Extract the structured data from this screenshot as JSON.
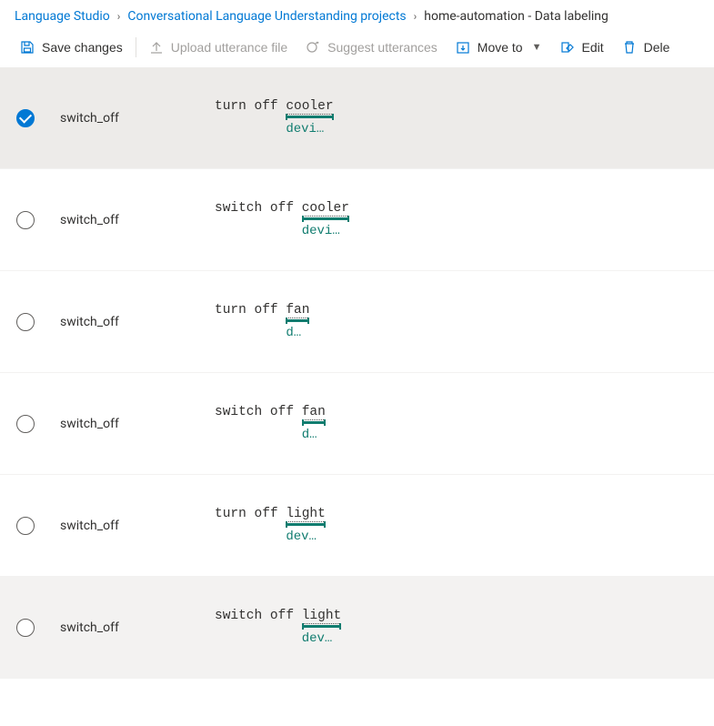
{
  "breadcrumb": {
    "items": [
      {
        "label": "Language Studio",
        "link": true
      },
      {
        "label": "Conversational Language Understanding projects",
        "link": true
      },
      {
        "label": "home-automation - Data labeling",
        "link": false
      }
    ]
  },
  "toolbar": {
    "save": "Save changes",
    "upload": "Upload utterance file",
    "suggest": "Suggest utterances",
    "moveto": "Move to",
    "edit": "Edit",
    "delete": "Dele"
  },
  "colors": {
    "link": "#0078d4",
    "entity": "#107c6f",
    "selected_row": "#edebe9",
    "hover_row": "#f3f2f1"
  },
  "rows": [
    {
      "selected": true,
      "intent": "switch_off",
      "prefix": "turn off ",
      "entity_text": "cooler",
      "entity_label": "devi…",
      "row_style": "sel"
    },
    {
      "selected": false,
      "intent": "switch_off",
      "prefix": "switch off ",
      "entity_text": "cooler",
      "entity_label": "devi…",
      "row_style": ""
    },
    {
      "selected": false,
      "intent": "switch_off",
      "prefix": "turn off ",
      "entity_text": "fan",
      "entity_label": "d…",
      "row_style": ""
    },
    {
      "selected": false,
      "intent": "switch_off",
      "prefix": "switch off ",
      "entity_text": "fan",
      "entity_label": "d…",
      "row_style": ""
    },
    {
      "selected": false,
      "intent": "switch_off",
      "prefix": "turn off ",
      "entity_text": "light",
      "entity_label": "dev…",
      "row_style": ""
    },
    {
      "selected": false,
      "intent": "switch_off",
      "prefix": "switch off ",
      "entity_text": "light",
      "entity_label": "dev…",
      "row_style": "hover"
    }
  ]
}
